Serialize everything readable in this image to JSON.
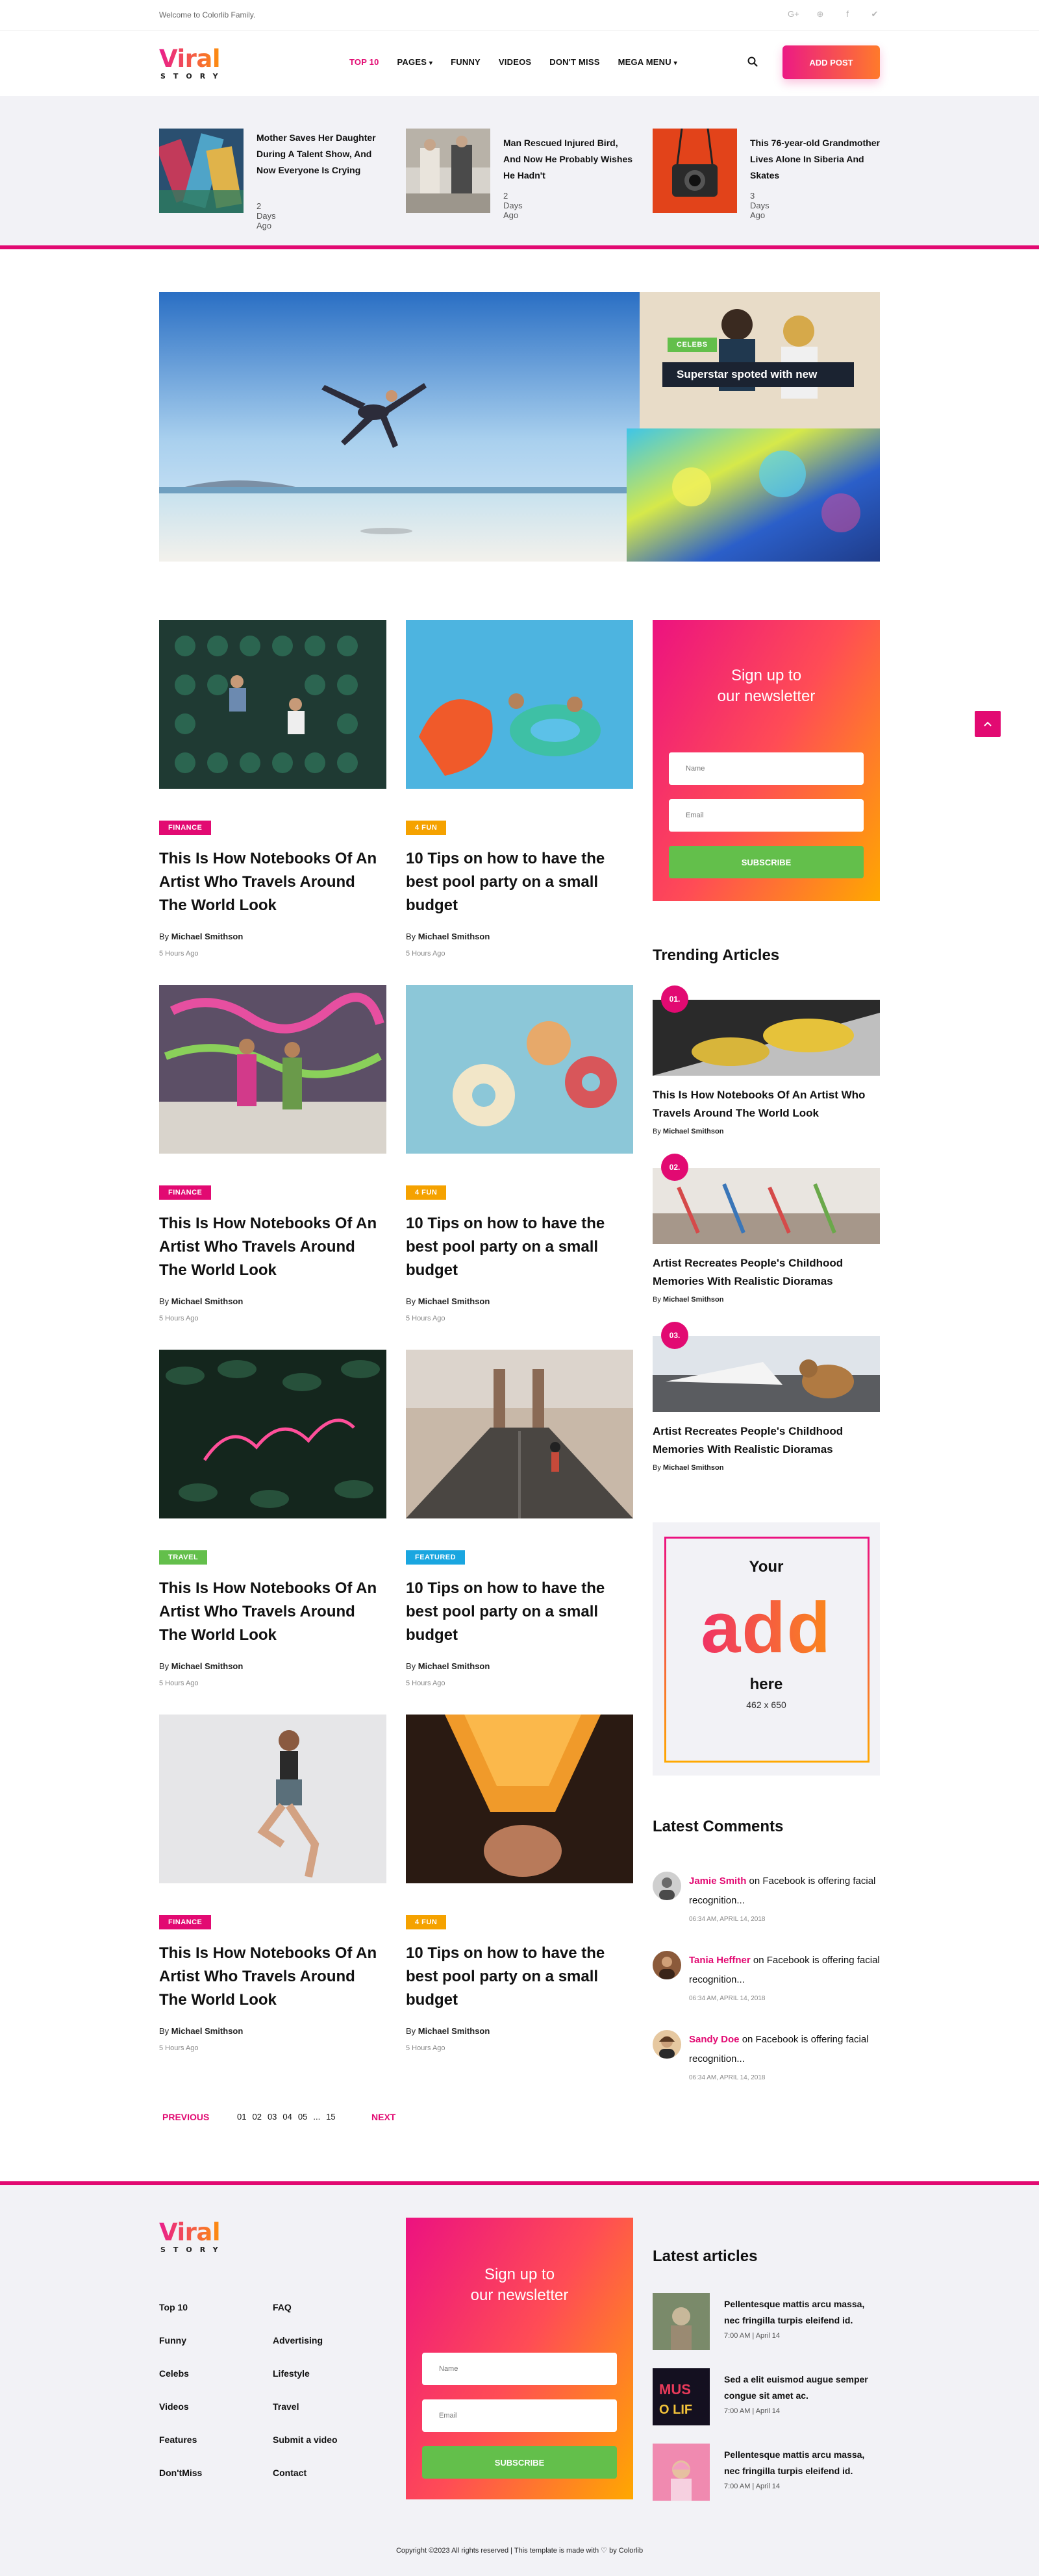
{
  "topbar": {
    "welcome": "Welcome to Colorlib Family.",
    "social_icons": [
      "google-plus-icon",
      "pinterest-icon",
      "facebook-icon",
      "twitter-icon"
    ]
  },
  "brand": {
    "name": "Viral",
    "sub": "STORY",
    "gradient": [
      "#e91e8c",
      "#ff9a00"
    ]
  },
  "nav": {
    "items": [
      "TOP 10",
      "PAGES",
      "FUNNY",
      "VIDEOS",
      "DON'T MISS",
      "MEGA MENU"
    ],
    "active": "TOP 10",
    "add_post": "ADD POST"
  },
  "top_stories": [
    {
      "title": "Mother Saves Her Daughter During A Talent Show, And Now Everyone Is Crying",
      "date": "2 Days Ago"
    },
    {
      "title": "Man Rescued Injured Bird, And Now He Probably Wishes He Hadn't",
      "date": "2 Days Ago"
    },
    {
      "title": "This 76-year-old Grandmother Lives Alone In Siberia And Skates",
      "date": "3 Days Ago"
    }
  ],
  "hero": {
    "badge": "CELEBS",
    "caption": "Superstar spoted with new"
  },
  "posts": [
    {
      "category": "FINANCE",
      "title": "This Is How Notebooks Of An Artist Who Travels Around The World Look",
      "by": "By",
      "author": "Michael Smithson",
      "time": "5 Hours Ago"
    },
    {
      "category": "4 FUN",
      "title": "10 Tips on how to have the best pool party on a small budget",
      "by": "By",
      "author": "Michael Smithson",
      "time": "5 Hours Ago"
    },
    {
      "category": "FINANCE",
      "title": "This Is How Notebooks Of An Artist Who Travels Around The World Look",
      "by": "By",
      "author": "Michael Smithson",
      "time": "5 Hours Ago"
    },
    {
      "category": "4 FUN",
      "title": "10 Tips on how to have the best pool party on a small budget",
      "by": "By",
      "author": "Michael Smithson",
      "time": "5 Hours Ago"
    },
    {
      "category": "TRAVEL",
      "title": "This Is How Notebooks Of An Artist Who Travels Around The World Look",
      "by": "By",
      "author": "Michael Smithson",
      "time": "5 Hours Ago"
    },
    {
      "category": "FEATURED",
      "title": "10 Tips on how to have the best pool party on a small budget",
      "by": "By",
      "author": "Michael Smithson",
      "time": "5 Hours Ago"
    },
    {
      "category": "FINANCE",
      "title": "This Is How Notebooks Of An Artist Who Travels Around The World Look",
      "by": "By",
      "author": "Michael Smithson",
      "time": "5 Hours Ago"
    },
    {
      "category": "4 FUN",
      "title": "10 Tips on how to have the best pool party on a small budget",
      "by": "By",
      "author": "Michael Smithson",
      "time": "5 Hours Ago"
    }
  ],
  "newsletter": {
    "heading_1": "Sign up to",
    "heading_2": "our newsletter",
    "name_placeholder": "Name",
    "email_placeholder": "Email",
    "button": "SUBSCRIBE"
  },
  "trending": {
    "title": "Trending Articles",
    "items": [
      {
        "num": "01.",
        "title": "This Is How Notebooks Of An Artist Who Travels Around The World Look",
        "by": "By",
        "author": "Michael Smithson"
      },
      {
        "num": "02.",
        "title": "Artist Recreates People's Childhood Memories With Realistic Dioramas",
        "by": "By",
        "author": "Michael Smithson"
      },
      {
        "num": "03.",
        "title": "Artist Recreates People's Childhood Memories With Realistic Dioramas",
        "by": "By",
        "author": "Michael Smithson"
      }
    ]
  },
  "ad": {
    "line1": "Your",
    "big": "add",
    "line2": "here",
    "size": "462 x 650"
  },
  "latest_comments": {
    "title": "Latest Comments",
    "items": [
      {
        "name": "Jamie Smith",
        "text": "on Facebook is offering facial recognition...",
        "meta": "06:34 AM, APRIL 14, 2018"
      },
      {
        "name": "Tania Heffner",
        "text": "on Facebook is offering facial recognition...",
        "meta": "06:34 AM, APRIL 14, 2018"
      },
      {
        "name": "Sandy Doe",
        "text": "on Facebook is offering facial recognition...",
        "meta": "06:34 AM, APRIL 14, 2018"
      }
    ]
  },
  "pagination": {
    "prev": "PREVIOUS",
    "pages": [
      "01",
      "02",
      "03",
      "04",
      "05",
      "...",
      "15"
    ],
    "next": "NEXT"
  },
  "footer": {
    "col1": [
      "Top 10",
      "Funny",
      "Celebs",
      "Videos",
      "Features",
      "Don'tMiss"
    ],
    "col2": [
      "FAQ",
      "Advertising",
      "Lifestyle",
      "Travel",
      "Submit a video",
      "Contact"
    ],
    "latest_title": "Latest articles",
    "articles": [
      {
        "title": "Pellentesque mattis arcu massa, nec fringilla turpis eleifend id.",
        "date": "7:00 AM | April 14"
      },
      {
        "title": "Sed a elit euismod augue semper congue sit amet ac.",
        "date": "7:00 AM | April 14"
      },
      {
        "title": "Pellentesque mattis arcu massa, nec fringilla turpis eleifend id.",
        "date": "7:00 AM | April 14"
      }
    ],
    "copyright": "Copyright ©2023 All rights reserved | This template is made with ♡ by Colorlib"
  }
}
